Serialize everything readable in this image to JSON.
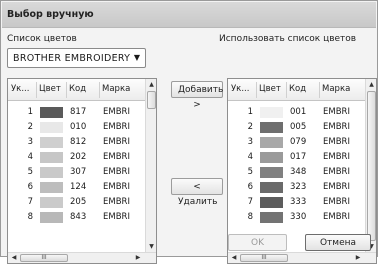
{
  "window": {
    "title": "Выбор вручную"
  },
  "left_panel": {
    "label": "Список цветов",
    "dropdown_value": "BROTHER EMBROIDERY",
    "columns": [
      "Ук...",
      "Цвет",
      "Код",
      "Марка"
    ],
    "rows": [
      {
        "num": "1",
        "color": "#5a5a5a",
        "code": "817",
        "brand": "EMBRI"
      },
      {
        "num": "2",
        "color": "#e8e8e8",
        "code": "010",
        "brand": "EMBRI"
      },
      {
        "num": "3",
        "color": "#cfcfcf",
        "code": "812",
        "brand": "EMBRI"
      },
      {
        "num": "4",
        "color": "#c6c6c6",
        "code": "202",
        "brand": "EMBRI"
      },
      {
        "num": "5",
        "color": "#c9c9c9",
        "code": "307",
        "brand": "EMBRI"
      },
      {
        "num": "6",
        "color": "#bdbdbd",
        "code": "124",
        "brand": "EMBRI"
      },
      {
        "num": "7",
        "color": "#cacaca",
        "code": "205",
        "brand": "EMBRI"
      },
      {
        "num": "8",
        "color": "#b8b8b8",
        "code": "843",
        "brand": "EMBRI"
      }
    ],
    "scroll_thumb_glyph": "III"
  },
  "right_panel": {
    "label": "Использовать список цветов",
    "columns": [
      "Ук...",
      "Цвет",
      "Код",
      "Марка"
    ],
    "rows": [
      {
        "num": "1",
        "color": "#f0f0f0",
        "code": "001",
        "brand": "EMBRI"
      },
      {
        "num": "2",
        "color": "#6e6e6e",
        "code": "005",
        "brand": "EMBRI"
      },
      {
        "num": "3",
        "color": "#a8a8a8",
        "code": "079",
        "brand": "EMBRI"
      },
      {
        "num": "4",
        "color": "#9a9a9a",
        "code": "017",
        "brand": "EMBRI"
      },
      {
        "num": "5",
        "color": "#808080",
        "code": "348",
        "brand": "EMBRI"
      },
      {
        "num": "6",
        "color": "#6a6a6a",
        "code": "323",
        "brand": "EMBRI"
      },
      {
        "num": "7",
        "color": "#5c5c5c",
        "code": "333",
        "brand": "EMBRI"
      },
      {
        "num": "8",
        "color": "#737373",
        "code": "330",
        "brand": "EMBRI"
      }
    ],
    "scroll_thumb_glyph": "III"
  },
  "buttons": {
    "add": "Добавить >",
    "remove": "< Удалить",
    "ok": "OK",
    "cancel": "Отмена"
  }
}
